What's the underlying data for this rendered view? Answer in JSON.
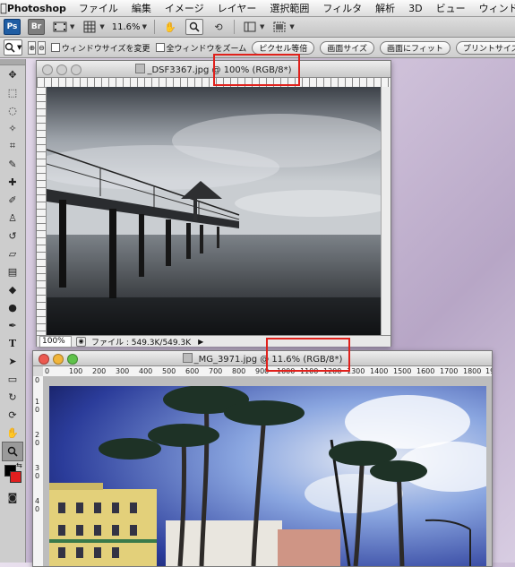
{
  "menubar": {
    "app_name": "Photoshop",
    "items": [
      "ファイル",
      "編集",
      "イメージ",
      "レイヤー",
      "選択範囲",
      "フィルタ",
      "解析",
      "3D",
      "ビュー",
      "ウィンドウ"
    ]
  },
  "appbar": {
    "ps_logo": "Ps",
    "br_logo": "Br",
    "zoom": "11.6%",
    "icons": [
      "film-icon",
      "grid-icon",
      "hand-icon",
      "zoom-icon",
      "rotate-view-icon",
      "arrange-icon",
      "screen-mode-icon"
    ]
  },
  "optbar": {
    "resize_window_label": "ウィンドウサイズを変更",
    "all_windows_label": "全ウィンドウをズーム",
    "actual_pixels": "ピクセル等倍",
    "fit_screen": "画面サイズ",
    "fill_screen": "画面にフィット",
    "print_size": "プリントサイズ"
  },
  "doc1": {
    "title": "_DSF3367.jpg @ 100% (RGB/8*)",
    "zoom": "100%",
    "file_info": "ファイル : 549.3K/549.3K"
  },
  "doc2": {
    "title": "_MG_3971.jpg @ 11.6% (RGB/8*)",
    "ruler_h": [
      "0",
      "100",
      "200",
      "300",
      "400",
      "500",
      "600",
      "700",
      "800",
      "900",
      "1000",
      "1100",
      "1200",
      "1300",
      "1400",
      "1500",
      "1600",
      "1700",
      "1800",
      "1900"
    ],
    "ruler_v": [
      "0",
      "1",
      "0",
      "2",
      "0",
      "3",
      "0",
      "4",
      "0"
    ]
  },
  "tools": [
    "move-icon",
    "marquee-icon",
    "lasso-icon",
    "magic-wand-icon",
    "crop-icon",
    "eyedropper-icon",
    "healing-brush-icon",
    "brush-icon",
    "clone-stamp-icon",
    "history-brush-icon",
    "eraser-icon",
    "gradient-icon",
    "blur-icon",
    "dodge-icon",
    "pen-icon",
    "type-icon",
    "path-select-icon",
    "shape-icon",
    "3d-rotate-icon",
    "3d-orbit-icon",
    "hand-icon",
    "zoom-icon"
  ],
  "colors": {
    "foreground": "#000000",
    "background": "#e01f1f",
    "highlight": "#e0201b"
  }
}
